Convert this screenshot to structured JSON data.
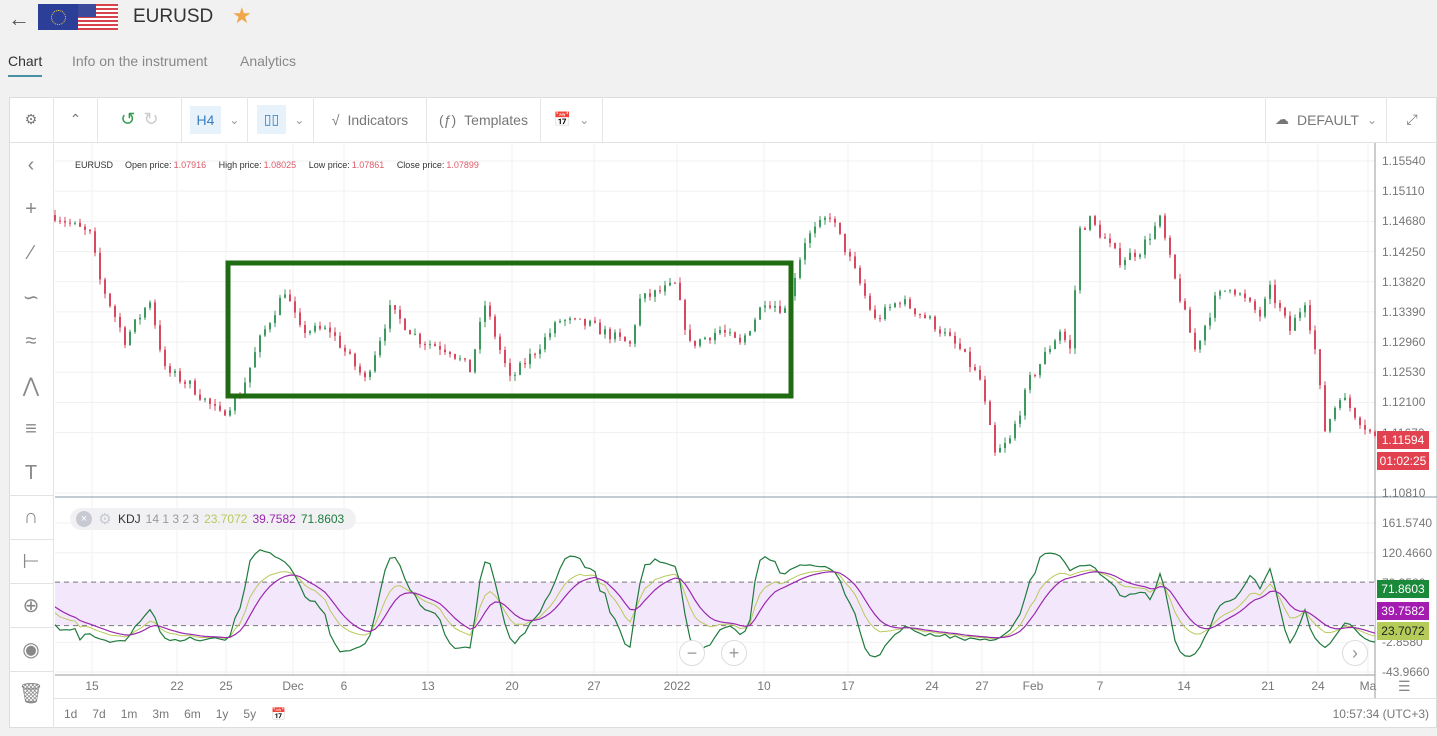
{
  "header": {
    "back_icon": "arrow-left-icon",
    "title": "EURUSD",
    "favorite_icon": "star-icon"
  },
  "tabs": [
    {
      "label": "Chart",
      "active": true
    },
    {
      "label": "Info on the instrument"
    },
    {
      "label": "Analytics"
    }
  ],
  "toolbar": {
    "timeframe": "H4",
    "indicators": "Indicators",
    "templates": "Templates",
    "layout": "DEFAULT"
  },
  "ohlc": {
    "symbol": "EURUSD",
    "open_label": "Open price:",
    "open": "1.07916",
    "high_label": "High price:",
    "high": "1.08025",
    "low_label": "Low price:",
    "low": "1.07861",
    "close_label": "Close price:",
    "close": "1.07899"
  },
  "kdj": {
    "name": "KDJ",
    "params": "14 1 3 2 3",
    "k": "23.7072",
    "d": "39.7582",
    "j": "71.8603"
  },
  "price_axis": [
    "1.15540",
    "1.15110",
    "1.14680",
    "1.14250",
    "1.13820",
    "1.13390",
    "1.12960",
    "1.12530",
    "1.12100",
    "1.11670",
    "1.10810"
  ],
  "current_price": "1.11594",
  "countdown": "01:02:25",
  "kdj_axis": [
    "161.5740",
    "120.4660",
    "79.3580",
    "-2.8580",
    "-43.9660"
  ],
  "time_axis": [
    "15",
    "22",
    "25",
    "Dec",
    "6",
    "13",
    "20",
    "27",
    "2022",
    "10",
    "17",
    "24",
    "27",
    "Feb",
    "7",
    "14",
    "21",
    "24",
    "Ma"
  ],
  "ranges": [
    "1d",
    "7d",
    "1m",
    "3m",
    "6m",
    "1y",
    "5y"
  ],
  "clock": "10:57:34 (UTC+3)",
  "colors": {
    "up": "#3c9a5f",
    "down": "#d9485f",
    "k": "#b9c95b",
    "d": "#9b27af",
    "j": "#1f7a3c",
    "highlight": "#1f6b12",
    "band": "#f3e8fb"
  },
  "chart_data": {
    "type": "candlestick",
    "symbol": "EURUSD",
    "timeframe": "H4",
    "ylim": [
      1.1081,
      1.1554
    ],
    "close_waypoints": [
      [
        0,
        1.1477
      ],
      [
        7,
        1.1449
      ],
      [
        9,
        1.1384
      ],
      [
        14,
        1.1299
      ],
      [
        19,
        1.1356
      ],
      [
        22,
        1.1256
      ],
      [
        27,
        1.1235
      ],
      [
        33,
        1.1192
      ],
      [
        37,
        1.1221
      ],
      [
        41,
        1.1299
      ],
      [
        46,
        1.137
      ],
      [
        49,
        1.1313
      ],
      [
        55,
        1.1313
      ],
      [
        62,
        1.1242
      ],
      [
        67,
        1.1342
      ],
      [
        73,
        1.1299
      ],
      [
        79,
        1.1285
      ],
      [
        83,
        1.1256
      ],
      [
        86,
        1.1349
      ],
      [
        91,
        1.1242
      ],
      [
        97,
        1.1292
      ],
      [
        101,
        1.1327
      ],
      [
        107,
        1.132
      ],
      [
        115,
        1.1292
      ],
      [
        117,
        1.1356
      ],
      [
        124,
        1.1377
      ],
      [
        127,
        1.1292
      ],
      [
        133,
        1.1313
      ],
      [
        137,
        1.1292
      ],
      [
        142,
        1.1356
      ],
      [
        146,
        1.1342
      ],
      [
        150,
        1.1441
      ],
      [
        155,
        1.1477
      ],
      [
        159,
        1.1413
      ],
      [
        164,
        1.1327
      ],
      [
        169,
        1.1356
      ],
      [
        175,
        1.1327
      ],
      [
        181,
        1.1285
      ],
      [
        185,
        1.1242
      ],
      [
        188,
        1.1135
      ],
      [
        191,
        1.1156
      ],
      [
        195,
        1.1242
      ],
      [
        201,
        1.1313
      ],
      [
        203,
        1.1285
      ],
      [
        205,
        1.1456
      ],
      [
        207,
        1.147
      ],
      [
        213,
        1.1413
      ],
      [
        217,
        1.1427
      ],
      [
        221,
        1.147
      ],
      [
        224,
        1.1384
      ],
      [
        228,
        1.1285
      ],
      [
        232,
        1.1356
      ],
      [
        235,
        1.1377
      ],
      [
        241,
        1.1334
      ],
      [
        243,
        1.137
      ],
      [
        247,
        1.1313
      ],
      [
        250,
        1.1356
      ],
      [
        252,
        1.1285
      ],
      [
        254,
        1.1171
      ],
      [
        257,
        1.1221
      ],
      [
        261,
        1.1185
      ],
      [
        264,
        1.1159
      ]
    ],
    "kdj_ylim": [
      -43.966,
      161.574
    ],
    "kdj_bands": [
      20,
      80
    ]
  }
}
